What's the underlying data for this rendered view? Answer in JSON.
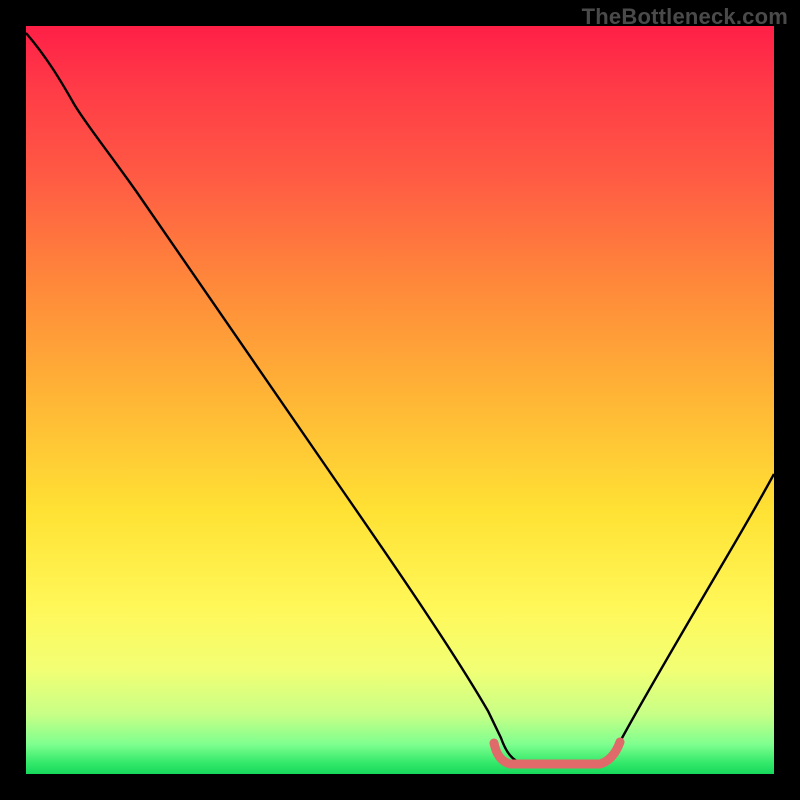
{
  "watermark": {
    "text": "TheBottleneck.com"
  },
  "colors": {
    "curve_stroke": "#000000",
    "optimum_marker": "#e06a6a",
    "frame_bg": "#000000"
  },
  "chart_data": {
    "type": "line",
    "title": "",
    "xlabel": "",
    "ylabel": "",
    "xlim": [
      0,
      100
    ],
    "ylim": [
      0,
      100
    ],
    "grid": false,
    "legend": false,
    "series": [
      {
        "name": "bottleneck-curve",
        "x": [
          0,
          5,
          10,
          15,
          20,
          25,
          30,
          35,
          40,
          45,
          50,
          55,
          60,
          65,
          70,
          75,
          80,
          85,
          90,
          95,
          100
        ],
        "values": [
          99,
          94,
          87,
          79,
          72,
          64,
          56,
          48,
          40,
          32,
          24,
          16,
          8,
          3,
          1,
          1,
          3,
          9,
          16,
          24,
          32
        ]
      }
    ],
    "optimum_range": {
      "x_start": 62,
      "x_end": 78,
      "y": 1
    },
    "annotations": []
  }
}
